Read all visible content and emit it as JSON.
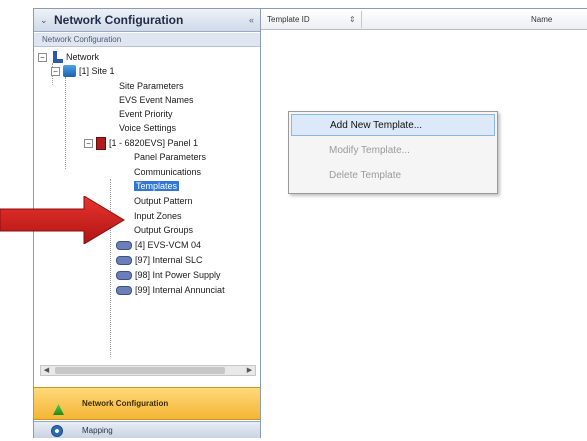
{
  "nav_pane": {
    "title": "Network Configuration",
    "breadcrumb": "Network Configuration",
    "tree": [
      {
        "label": "Network",
        "level": 0,
        "expander": "−",
        "icon": "network-icon"
      },
      {
        "label": "[1] Site 1",
        "level": 1,
        "expander": "−",
        "icon": "site-icon"
      },
      {
        "label": "Site Parameters",
        "level": 2
      },
      {
        "label": "EVS Event Names",
        "level": 2
      },
      {
        "label": "Event Priority",
        "level": 2
      },
      {
        "label": "Voice Settings",
        "level": 2
      },
      {
        "label": "[1 - 6820EVS] Panel 1",
        "level": 2,
        "expander": "−",
        "icon": "panel-icon"
      },
      {
        "label": "Panel Parameters",
        "level": 3
      },
      {
        "label": "Communications",
        "level": 3
      },
      {
        "label": "Templates",
        "level": 3,
        "selected": true
      },
      {
        "label": "Output Pattern",
        "level": 3
      },
      {
        "label": "Input Zones",
        "level": 3
      },
      {
        "label": "Output Groups",
        "level": 3
      },
      {
        "label": "[4] EVS-VCM 04",
        "level": 3,
        "icon": "module-icon"
      },
      {
        "label": "[97] Internal SLC",
        "level": 3,
        "icon": "module-icon"
      },
      {
        "label": "[98] Int Power Supply",
        "level": 3,
        "icon": "module-icon"
      },
      {
        "label": "[99] Internal Annunciat",
        "level": 3,
        "icon": "module-icon"
      }
    ],
    "nav_buttons": {
      "active": "Network Configuration",
      "next": "Mapping"
    }
  },
  "grid": {
    "columns": [
      "Template ID",
      "Name"
    ]
  },
  "context_menu": {
    "items": [
      {
        "label": "Add New Template...",
        "state": "highlighted"
      },
      {
        "label": "Modify Template...",
        "state": "disabled"
      },
      {
        "label": "Delete Template",
        "state": "disabled"
      }
    ]
  },
  "colors": {
    "selection": "#3076d4",
    "active_nav": "#f4b534",
    "arrow": "#d11e1e"
  }
}
